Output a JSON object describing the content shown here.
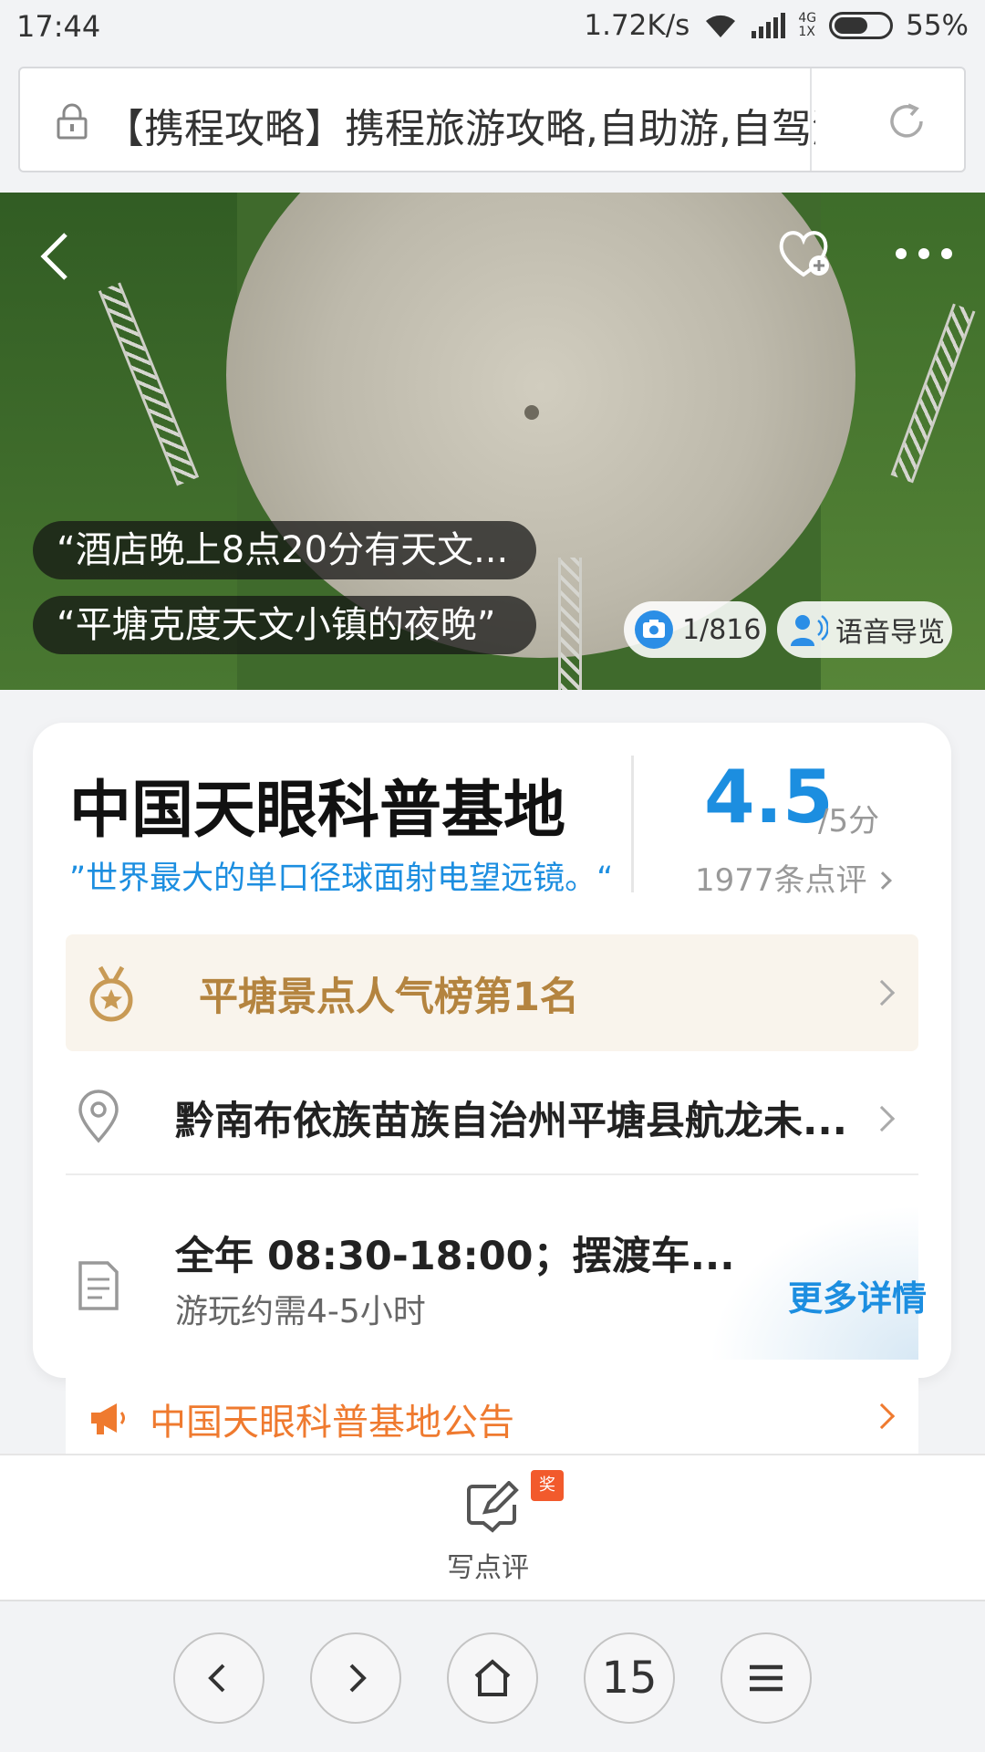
{
  "status_bar": {
    "time": "17:44",
    "net_speed": "1.72K/s",
    "net_type_top": "4G",
    "net_type_bottom": "1X",
    "battery": "55%"
  },
  "url_bar": {
    "url_text": "【携程攻略】携程旅游攻略,自助游,自驾游"
  },
  "hero": {
    "quote1": "“酒店晚上8点20分有天文...",
    "quote2": "“平塘克度天文小镇的夜晚”",
    "photo_count": "1/816",
    "audio_guide": "语音导览"
  },
  "poi": {
    "title": "中国天眼科普基地",
    "slogan": "”世界最大的单口径球面射电望远镜。“",
    "rating": "4.5",
    "rating_max": "/5分",
    "review_count": "1977条点评",
    "rank": "平塘景点人气榜第1名",
    "address": "黔南布依族苗族自治州平塘县航龙未...",
    "hours": "全年 08:30-18:00；摆渡车...",
    "duration": "游玩约需4-5小时",
    "more_details": "更多详情",
    "notice": "中国天眼科普基地公告"
  },
  "review_bar": {
    "badge": "奖",
    "label": "写点评"
  },
  "toolbar": {
    "tab_count": "15"
  },
  "colors": {
    "accent_blue": "#1c8ee0",
    "rank_gold": "#b4843f",
    "notice_orange": "#ef7a2f",
    "badge_red": "#f25a2c"
  }
}
